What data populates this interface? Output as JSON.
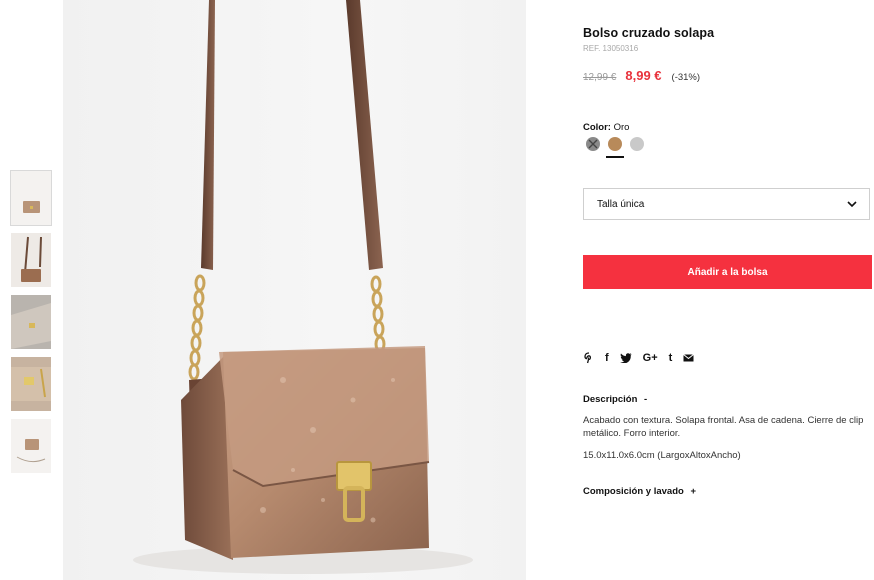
{
  "product": {
    "title": "Bolso cruzado solapa",
    "ref": "REF. 13050316",
    "old_price": "12,99 €",
    "sale_price": "8,99 €",
    "discount": "(-31%)"
  },
  "color": {
    "label": "Color:",
    "value": "Oro",
    "swatches": [
      {
        "name": "unavailable",
        "hex": "#8a8a8a"
      },
      {
        "name": "Oro",
        "hex": "#b88a5a"
      },
      {
        "name": "silver",
        "hex": "#c9c9c9"
      }
    ]
  },
  "size": {
    "selected": "Talla única"
  },
  "actions": {
    "add_to_bag": "Añadir a la bolsa"
  },
  "share": {
    "pinterest": "P",
    "facebook": "f",
    "twitter": "t",
    "google_plus": "G+",
    "tumblr": "t",
    "mail": "✉"
  },
  "description": {
    "title": "Descripción",
    "toggle": "-",
    "text": "Acabado con textura. Solapa frontal. Asa de cadena. Cierre de clip metálico. Forro interior.",
    "dimensions": "15.0x11.0x6.0cm (LargoxAltoxAncho)"
  },
  "composition": {
    "title": "Composición y lavado",
    "toggle": "+"
  }
}
